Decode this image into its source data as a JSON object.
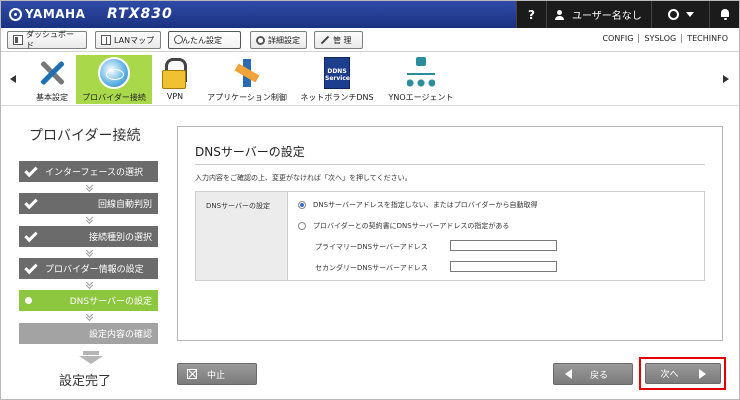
{
  "header": {
    "brand": "YAMAHA",
    "model": "RTX830",
    "help": "?",
    "user": "ユーザー名なし"
  },
  "nav": {
    "buttons": [
      "ダッシュボード",
      "LANマップ",
      "かんたん設定",
      "詳細設定",
      "管 理"
    ],
    "links": [
      "CONFIG",
      "SYSLOG",
      "TECHINFO"
    ]
  },
  "toolbar": {
    "items": [
      "基本設定",
      "プロバイダー接続",
      "VPN",
      "アプリケーション制御",
      "ネットボランチDNS",
      "YNOエージェント"
    ],
    "dns_icon_text": "DDNS Service"
  },
  "wizard": {
    "title": "プロバイダー接続",
    "steps": [
      "インターフェースの選択",
      "回線自動判別",
      "接続種別の選択",
      "プロバイダー情報の設定",
      "DNSサーバーの設定",
      "設定内容の確認"
    ],
    "final": "設定完了"
  },
  "main": {
    "title": "DNSサーバーの設定",
    "description": "入力内容をご確認の上、変更がなければ「次へ」を押してください。",
    "form_label": "DNSサーバーの設定",
    "option_auto": "DNSサーバーアドレスを指定しない、またはプロバイダーから自動取得",
    "option_manual": "プロバイダーとの契約書にDNSサーバーアドレスの指定がある",
    "primary_label": "プライマリーDNSサーバーアドレス",
    "secondary_label": "セカンダリーDNSサーバーアドレス",
    "primary_value": "",
    "secondary_value": ""
  },
  "buttons": {
    "cancel": "中止",
    "back": "戻る",
    "next": "次へ"
  },
  "colors": {
    "header_bg": "#1a3281",
    "active_green": "#8dc63f",
    "highlight_red": "#e00000"
  }
}
